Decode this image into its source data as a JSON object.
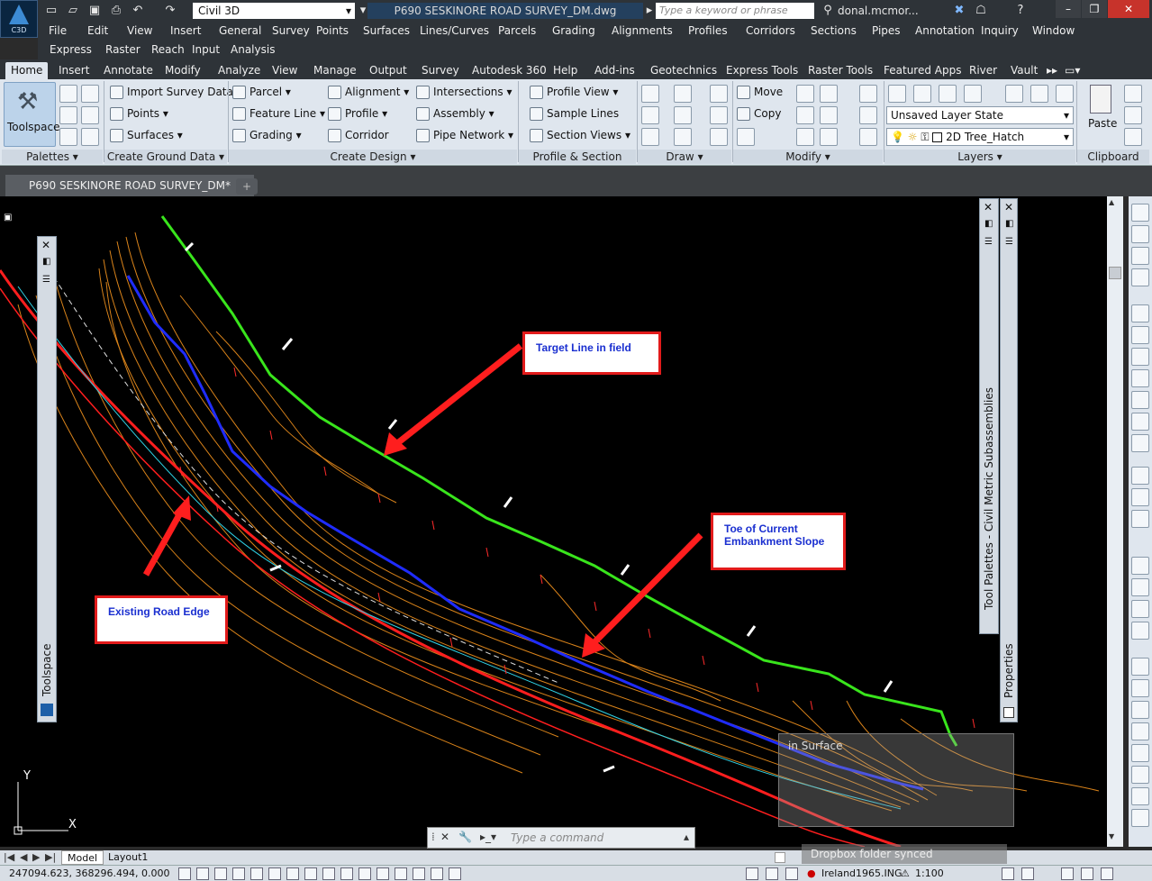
{
  "app": {
    "logo_text": "C3D",
    "workspace": "Civil 3D",
    "title": "P690 SESKINORE ROAD SURVEY_DM.dwg",
    "search_placeholder": "Type a keyword or phrase",
    "user": "donal.mcmor..."
  },
  "menu": [
    "File",
    "Edit",
    "View",
    "Insert",
    "General",
    "Survey",
    "Points",
    "Surfaces",
    "Lines/Curves",
    "Parcels",
    "Grading",
    "Alignments",
    "Profiles",
    "Corridors",
    "Sections",
    "Pipes",
    "Annotation",
    "Inquiry",
    "Window",
    "Express",
    "Raster",
    "Reach",
    "Input",
    "Analysis"
  ],
  "tabs": [
    "Home",
    "Insert",
    "Annotate",
    "Modify",
    "Analyze",
    "View",
    "Manage",
    "Output",
    "Survey",
    "Autodesk 360",
    "Help",
    "Add-ins",
    "Geotechnics",
    "Express Tools",
    "Raster Tools",
    "Featured Apps",
    "River",
    "Vault"
  ],
  "ribbon": {
    "toolspace": "Toolspace",
    "ground": [
      "Import Survey Data",
      "Points",
      "Surfaces"
    ],
    "design_col1": [
      "Parcel",
      "Feature Line",
      "Grading"
    ],
    "design_col2": [
      "Alignment",
      "Profile",
      "Corridor"
    ],
    "design_col3": [
      "Intersections",
      "Assembly",
      "Pipe Network"
    ],
    "views": [
      "Profile View",
      "Sample Lines",
      "Section Views"
    ],
    "modify": [
      "Move",
      "Copy"
    ],
    "layer_state": "Unsaved Layer State",
    "layer": "2D Tree_Hatch",
    "paste": "Paste",
    "panels": [
      "Palettes",
      "Create Ground Data",
      "Create Design",
      "Profile & Section Views",
      "Draw",
      "Modify",
      "Layers",
      "Clipboard"
    ]
  },
  "doc_tab": "P690 SESKINORE ROAD SURVEY_DM*",
  "palettes": {
    "left": "Toolspace",
    "right1": "Tool Palettes - Civil Metric Subassemblies",
    "right2": "Properties"
  },
  "callouts": {
    "target": "Target Line in field",
    "toe": "Toe of Current Embankment Slope",
    "edge": "Existing Road Edge"
  },
  "tooltip": "in Surface",
  "ucs": {
    "y": "Y",
    "x": "X"
  },
  "command_placeholder": "Type a command",
  "layout_tabs": [
    "Model",
    "Layout1"
  ],
  "status": {
    "coords": "247094.623, 368296.494, 0.000",
    "cs": "Ireland1965.ING",
    "scale": "1:100",
    "toast": "Dropbox folder synced"
  },
  "colors": {
    "green": "#39e51c",
    "blue": "#1f2cff",
    "red": "#ff1e1e",
    "contour": "#ff9a1f"
  }
}
